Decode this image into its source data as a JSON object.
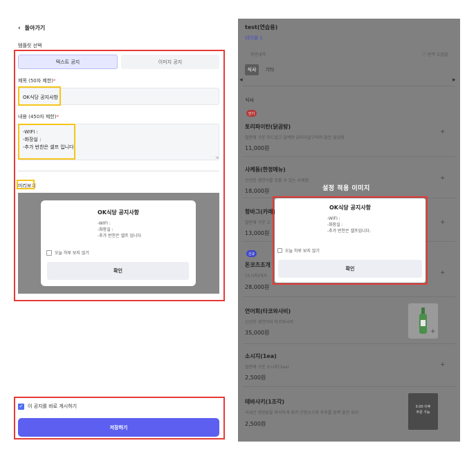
{
  "editor": {
    "back_label": "돌아가기",
    "template_title": "템플릿 선택",
    "tabs": [
      {
        "label": "텍스트 공지",
        "active": true
      },
      {
        "label": "이미지 공지",
        "active": false
      }
    ],
    "title_label": "제목 (50자 제한)",
    "title_required": "*",
    "title_value": "OK식당 공지사항",
    "content_label": "내용 (450자 제한)",
    "content_required": "*",
    "content_lines": [
      "-WIFI :",
      "-화장실 :",
      "-추가 반찬은 셀프 입니다"
    ],
    "preview_label": "미리보기",
    "preview_modal": {
      "title": "OK식당 공지사항",
      "lines": [
        "-WIFI :",
        "-화장실 :",
        "-추가 반찬은 셀프 입니다"
      ],
      "dont_show": "오늘 하루 보지 않기",
      "confirm": "확인"
    },
    "publish_label": "이 공지를 바로 게시하기",
    "save_label": "저장하기"
  },
  "menu": {
    "store": "test(연습용)",
    "table": "테이블 1",
    "order_history": "주문내역",
    "help": "번역 도움말",
    "segments": [
      {
        "label": "식사",
        "active": true
      },
      {
        "label": "기타",
        "active": false
      }
    ],
    "section": "식사",
    "items": [
      {
        "badge": "인기",
        "name": "토리파이탄(닭곰탕)",
        "desc": "철판에 구운 부드럽고 담백한 닭다리살구이와 맑은 닭곰탕",
        "price": "11,000원"
      },
      {
        "name": "사케동(한정메뉴)",
        "desc": "신선한 생연어를 맛볼 수 있는 사케동",
        "price": "18,000원"
      },
      {
        "name": "항바그(카레)",
        "desc": "철판에 구운 고",
        "price": "13,000원"
      },
      {
        "badge": "신규",
        "name": "돈코츠조개",
        "desc": "(소시지/데사",
        "price": "28,000원"
      },
      {
        "name": "연어회(타코와사비)",
        "desc": "신선한 생연어와 타코와사비",
        "price": "35,000원"
      },
      {
        "name": "소시지(1ea)",
        "desc": "철판에 구운 소시지(1ea)",
        "price": "2,500원"
      },
      {
        "name": "테바사키(1조각)",
        "desc": "국내산 냉장닭을 바삭하게 튀겨 간장소스와 후추를 듬뿍 올린 요리",
        "price": "2,500원",
        "note": "3:00 이후\n주문 가능"
      }
    ],
    "overlay_caption": "설정 적용 이미지",
    "applied_modal": {
      "title": "OK식당 공지사항",
      "lines": [
        "-WIFI :",
        "-화장실 :",
        "-추가 반찬은 셀프입니다."
      ],
      "dont_show": "오늘 하루 보지 않기",
      "confirm": "확인"
    }
  },
  "colors": {
    "accent": "#5c5fef",
    "highlight_red": "#e53935",
    "highlight_yellow": "#f5c518",
    "overlay_gray": "#808080"
  }
}
